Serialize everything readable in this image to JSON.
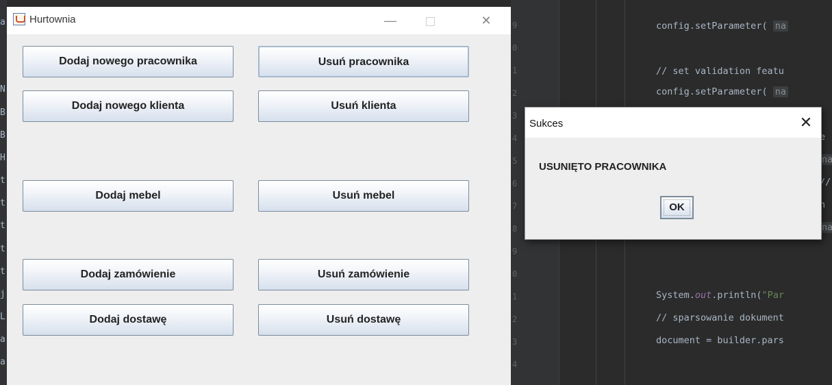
{
  "main_window": {
    "title": "Hurtownia",
    "buttons": {
      "add_employee": "Dodaj nowego pracownika",
      "remove_employee": "Usuń pracownika",
      "add_client": "Dodaj nowego klienta",
      "remove_client": "Usuń klienta",
      "add_furniture": "Dodaj mebel",
      "remove_furniture": "Usuń mebel",
      "add_order": "Dodaj zamówienie",
      "remove_order": "Usuń zamówienie",
      "add_delivery": "Dodaj dostawę",
      "remove_delivery": "Usuń dostawę"
    },
    "controls": {
      "minimize": "—",
      "close": "✕"
    }
  },
  "dialog": {
    "title": "Sukces",
    "message": "USUNIĘTO PRACOWNIKA",
    "ok_label": "OK",
    "close": "✕"
  },
  "ide": {
    "left_gutter_chars": [
      "a",
      "N",
      "B",
      "B",
      "H",
      "t",
      "t",
      "t",
      "t",
      "t",
      "j",
      "L",
      "a",
      "a"
    ],
    "line_numbers": [
      "9",
      "0",
      "1",
      "2",
      "3",
      "4",
      "5",
      "6",
      "7",
      "8",
      "9",
      "0",
      "1",
      "2",
      "3",
      "4"
    ],
    "code": {
      "config1_obj": "config",
      "config1_call": ".setParameter(",
      "config1_hint": "na",
      "comment1": "// set validation featu",
      "config2_obj": "config",
      "config2_call": ".setParameter(",
      "config2_hint": "na",
      "frag1": "e",
      "frag2": "na",
      "frag3": "//",
      "frag4": "n",
      "frag5": "na",
      "println_prefix": "System.",
      "println_field": "out",
      "println_call": ".println(",
      "println_str": "\"Par",
      "comment2": "// sparsowanie dokument",
      "doc_line": "document = builder.pars"
    }
  }
}
